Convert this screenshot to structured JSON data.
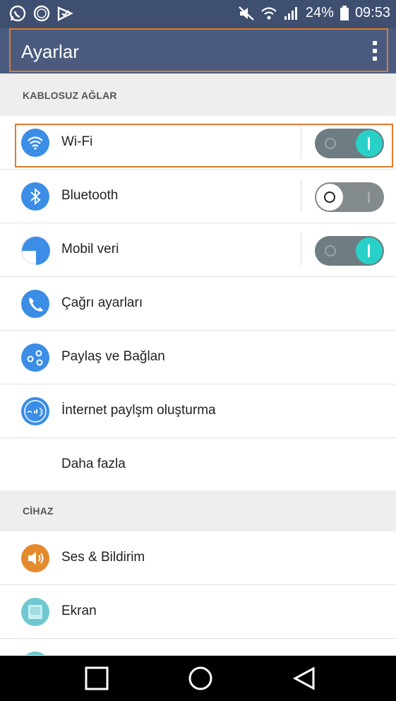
{
  "status_bar": {
    "battery": "24%",
    "time": "09:53",
    "icons": [
      "whatsapp-icon",
      "clock-icon",
      "check-notification-icon",
      "mute-icon",
      "wifi-icon",
      "signal-icon",
      "battery-icon"
    ]
  },
  "app_bar": {
    "title": "Ayarlar",
    "menu_icon": "overflow-menu-icon"
  },
  "sections": [
    {
      "title": "KABLOSUZ AĞLAR",
      "items": [
        {
          "label": "Wi-Fi",
          "icon": "wifi-icon",
          "toggle": "on"
        },
        {
          "label": "Bluetooth",
          "icon": "bluetooth-icon",
          "toggle": "off"
        },
        {
          "label": "Mobil veri",
          "icon": "mobile-data-icon",
          "toggle": "on"
        },
        {
          "label": "Çağrı ayarları",
          "icon": "phone-icon"
        },
        {
          "label": "Paylaş ve Bağlan",
          "icon": "share-icon"
        },
        {
          "label": "İnternet paylşm oluşturma",
          "icon": "tethering-icon"
        },
        {
          "label": "Daha fazla"
        }
      ]
    },
    {
      "title": "CİHAZ",
      "items": [
        {
          "label": "Ses & Bildirim",
          "icon": "sound-icon"
        },
        {
          "label": "Ekran",
          "icon": "display-icon"
        }
      ]
    }
  ],
  "colors": {
    "status_bar": "#3f4f70",
    "app_bar": "#4a5b7f",
    "accent_teal": "#28d0c8",
    "icon_blue": "#3b8de6",
    "highlight": "#e07b2c"
  },
  "nav_bar": {
    "buttons": [
      "recent-apps-button",
      "home-button",
      "back-button"
    ]
  }
}
